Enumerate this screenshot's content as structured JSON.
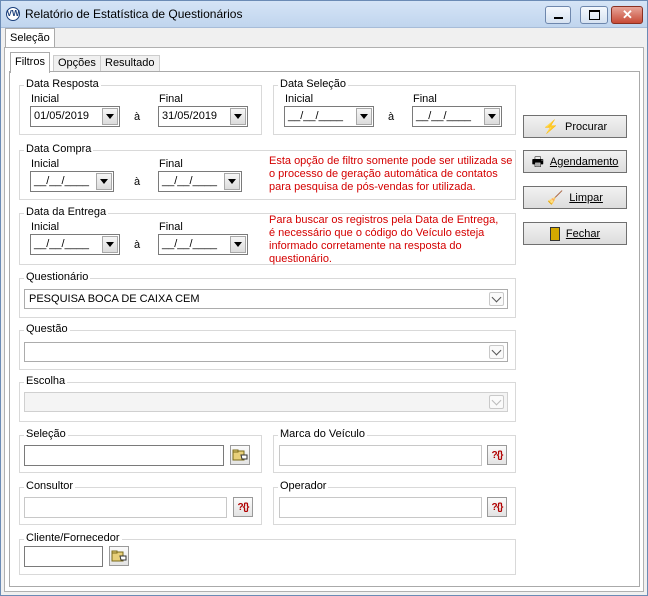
{
  "window": {
    "title": "Relatório de Estatística de Questionários"
  },
  "top_tabs": {
    "selecao": "Seleção"
  },
  "inner_tabs": {
    "filtros": "Filtros",
    "opcoes": "Opções",
    "resultado": "Resultado"
  },
  "data_resposta": {
    "legend": "Data Resposta",
    "inicial_label": "Inicial",
    "final_label": "Final",
    "inicial_value": "01/05/2019",
    "final_value": "31/05/2019",
    "sep": "à"
  },
  "data_selecao": {
    "legend": "Data Seleção",
    "inicial_label": "Inicial",
    "final_label": "Final",
    "inicial_value": "__/__/____",
    "final_value": "__/__/____",
    "sep": "à"
  },
  "data_compra": {
    "legend": "Data Compra",
    "inicial_label": "Inicial",
    "final_label": "Final",
    "inicial_value": "__/__/____",
    "final_value": "__/__/____",
    "sep": "à",
    "note": [
      "Esta opção de filtro somente pode ser utilizada se",
      "o processo de geração automática de contatos",
      "para pesquisa de pós-vendas for utilizada."
    ]
  },
  "data_entrega": {
    "legend": "Data da Entrega",
    "inicial_label": "Inicial",
    "final_label": "Final",
    "inicial_value": "__/__/____",
    "final_value": "__/__/____",
    "sep": "à",
    "note": [
      "Para buscar os registros pela Data de Entrega,",
      "é necessário que o código do Veículo esteja",
      "informado corretamente na resposta do",
      "questionário."
    ]
  },
  "questionario": {
    "legend": "Questionário",
    "value": "PESQUISA BOCA DE CAIXA CEM"
  },
  "questao": {
    "legend": "Questão",
    "value": ""
  },
  "escolha": {
    "legend": "Escolha",
    "value": ""
  },
  "selecao": {
    "legend": "Seleção"
  },
  "marca_veiculo": {
    "legend": "Marca do Veículo"
  },
  "consultor": {
    "legend": "Consultor"
  },
  "operador": {
    "legend": "Operador"
  },
  "cliente_fornecedor": {
    "legend": "Cliente/Fornecedor"
  },
  "buttons": {
    "procurar": "Procurar",
    "agendamento": "Agendamento",
    "limpar": "Limpar",
    "fechar": "Fechar"
  },
  "icons": {
    "lookup": "?{}",
    "folder": "folder-hand-icon"
  }
}
